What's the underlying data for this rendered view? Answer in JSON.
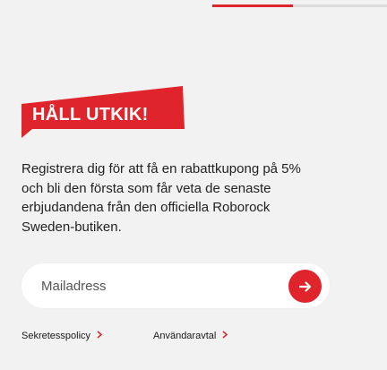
{
  "progress": {
    "fraction": 0.46,
    "fill_color": "#e0242b",
    "track_color": "#dcdcdc"
  },
  "headline": {
    "text": "HÅLL UTKIK!",
    "banner_color": "#e0242b"
  },
  "intro": {
    "lines": [
      "Registrera dig för att få en rabattkupong på 5%",
      "och bli den första som får veta de senaste",
      "erbjudandena från den officiella Roborock",
      "Sweden-butiken."
    ]
  },
  "newsletter": {
    "placeholder": "Mailadress",
    "value": "",
    "submit_icon": "arrow-right-icon"
  },
  "links": {
    "privacy": "Sekretesspolicy",
    "terms": "Användaravtal",
    "chevron_icon": "chevron-right-icon",
    "chevron_color": "#e0242b"
  }
}
